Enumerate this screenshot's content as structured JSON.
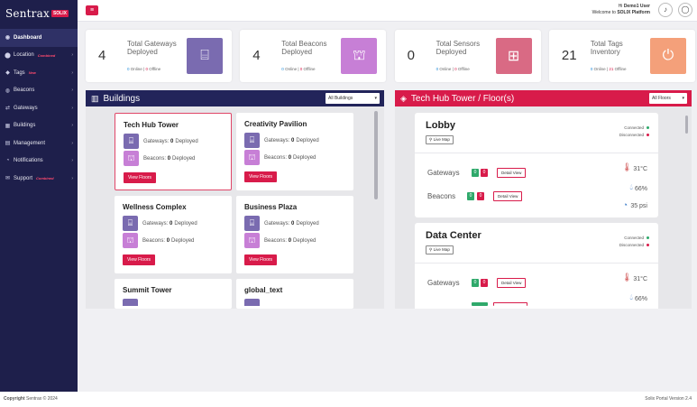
{
  "brand": {
    "name": "Sentrax",
    "badge": "SOLIX"
  },
  "nav": [
    {
      "label": "Dashboard",
      "icon": "dashboard-icon",
      "glyph": "◉",
      "active": true,
      "tag": "",
      "chev": false
    },
    {
      "label": "Location",
      "icon": "location-pin-icon",
      "glyph": "⬤",
      "active": false,
      "tag": "Combined",
      "chev": true
    },
    {
      "label": "Tags",
      "icon": "tag-icon",
      "glyph": "◆",
      "active": false,
      "tag": "New",
      "chev": true
    },
    {
      "label": "Beacons",
      "icon": "beacon-icon",
      "glyph": "◍",
      "active": false,
      "tag": "",
      "chev": true
    },
    {
      "label": "Gateways",
      "icon": "gateway-icon",
      "glyph": "⇄",
      "active": false,
      "tag": "",
      "chev": true
    },
    {
      "label": "Buildings",
      "icon": "building-icon",
      "glyph": "▦",
      "active": false,
      "tag": "",
      "chev": true
    },
    {
      "label": "Management",
      "icon": "management-icon",
      "glyph": "▤",
      "active": false,
      "tag": "",
      "chev": true
    },
    {
      "label": "Notifications",
      "icon": "bell-icon",
      "glyph": "◔",
      "active": false,
      "tag": "",
      "chev": true
    },
    {
      "label": "Support",
      "icon": "support-icon",
      "glyph": "✉",
      "active": false,
      "tag": "Combined",
      "chev": true
    }
  ],
  "topbar": {
    "greeting_prefix": "Hi",
    "user": "Demo1 User",
    "welcome": "Welcome to",
    "platform": "SOLIX Platform"
  },
  "stats": [
    {
      "count": "4",
      "label": "Total Gateways Deployed",
      "online": "0",
      "offline": "0",
      "online_label": "Online",
      "offline_label": "Offline",
      "icon": "router-icon",
      "color": "#7a6bb0"
    },
    {
      "count": "4",
      "label": "Total Beacons Deployed",
      "online": "0",
      "offline": "0",
      "online_label": "Online",
      "offline_label": "Offline",
      "icon": "beacon-light-icon",
      "color": "#c77fd6"
    },
    {
      "count": "0",
      "label": "Total Sensors Deployed",
      "online": "0",
      "offline": "0",
      "online_label": "Online",
      "offline_label": "Offline",
      "icon": "sensor-device-icon",
      "color": "#d96a84"
    },
    {
      "count": "21",
      "label": "Total Tags Inventory",
      "online": "0",
      "offline": "21",
      "online_label": "Online",
      "offline_label": "Offline",
      "icon": "tag-device-icon",
      "color": "#f4a07a"
    }
  ],
  "buildings_panel": {
    "title": "Buildings",
    "filter": "All Buildings",
    "gateways_label": "Deployed",
    "beacons_label": "Deployed",
    "gw_prefix": "Gateways:",
    "bc_prefix": "Beacons:",
    "view_label": "View Floors",
    "items": [
      {
        "name": "Tech Hub Tower",
        "gateways": "0",
        "beacons": "0"
      },
      {
        "name": "Creativity Pavilion",
        "gateways": "0",
        "beacons": "0"
      },
      {
        "name": "Wellness Complex",
        "gateways": "0",
        "beacons": "0"
      },
      {
        "name": "Business Plaza",
        "gateways": "0",
        "beacons": "0"
      },
      {
        "name": "Summit Tower"
      },
      {
        "name": "global_text"
      }
    ]
  },
  "floors_panel": {
    "title": "Tech Hub Tower / Floor(s)",
    "filter": "All Floors",
    "live_map": "Live Map",
    "connected": "Connected",
    "disconnected": "Disconnected",
    "gateways_label": "Gateways",
    "beacons_label": "Beacons",
    "detail": "Detail View",
    "floors": [
      {
        "name": "Lobby",
        "gw_on": "0",
        "gw_off": "0",
        "bc_on": "0",
        "bc_off": "0",
        "temp": "31°C",
        "humidity": "66%",
        "pressure": "35 psi"
      },
      {
        "name": "Data Center",
        "gw_on": "0",
        "gw_off": "0",
        "temp": "31°C",
        "humidity": "66%"
      }
    ]
  },
  "footer": {
    "copyright_bold": "Copyright",
    "copyright": "Sentrax © 2024",
    "version": "Solix Portal Version 2.4"
  },
  "colors": {
    "accent": "#d81b4a",
    "sidebar": "#1e1f4b",
    "online": "#1d8ad8",
    "green": "#2fa96b"
  }
}
